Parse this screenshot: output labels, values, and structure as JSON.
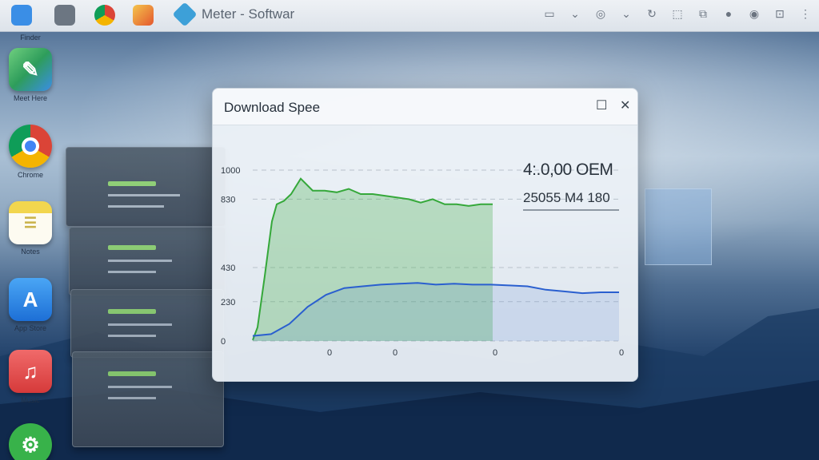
{
  "browser": {
    "tab_title": "Meter - Softwar"
  },
  "dock": {
    "items": [
      {
        "label": "Finder",
        "icon": "finder-icon",
        "color": "#3a8ee6"
      },
      {
        "label": "Meet Here",
        "icon": "maps-icon",
        "color": "#2e9d5b"
      },
      {
        "label": "Chrome",
        "icon": "chrome-icon",
        "color": "#e3e7ec"
      },
      {
        "label": "Notes",
        "icon": "notes-icon",
        "color": "#f2d64e"
      },
      {
        "label": "App Store",
        "icon": "appstore-icon",
        "color": "#2b82e8"
      },
      {
        "label": "Music",
        "icon": "music-icon",
        "color": "#e24a4a"
      },
      {
        "label": "Settings",
        "icon": "settings-icon",
        "color": "#38b24a"
      }
    ]
  },
  "window": {
    "title": "Download Spee",
    "readout_primary": "4:.0,00 OEM",
    "readout_secondary": "25055 M4 180"
  },
  "chart_data": {
    "type": "line",
    "y_tick_labels": [
      "1000",
      "830",
      "430",
      "230",
      "0"
    ],
    "x_tick_labels": [
      "0",
      "0",
      "0",
      "0"
    ],
    "series": [
      {
        "color": "#35a83a",
        "x": [
          0,
          0.02,
          0.05,
          0.08,
          0.1,
          0.13,
          0.16,
          0.2,
          0.25,
          0.3,
          0.35,
          0.4,
          0.45,
          0.5,
          0.55,
          0.6,
          0.65,
          0.7,
          0.75,
          0.8,
          0.85,
          0.9,
          0.95,
          1.0
        ],
        "y": [
          5,
          80,
          380,
          700,
          800,
          820,
          860,
          950,
          880,
          880,
          870,
          890,
          860,
          860,
          850,
          840,
          830,
          810,
          830,
          800,
          800,
          790,
          800,
          800
        ]
      },
      {
        "color": "#2a5fcf",
        "x": [
          0,
          0.05,
          0.1,
          0.15,
          0.2,
          0.25,
          0.3,
          0.35,
          0.4,
          0.45,
          0.5,
          0.55,
          0.6,
          0.65,
          0.7,
          0.75,
          0.8,
          0.85,
          0.9,
          0.95,
          1.0
        ],
        "y": [
          30,
          40,
          100,
          200,
          270,
          310,
          320,
          330,
          335,
          340,
          330,
          335,
          330,
          330,
          325,
          320,
          300,
          290,
          280,
          285,
          285
        ]
      }
    ]
  }
}
